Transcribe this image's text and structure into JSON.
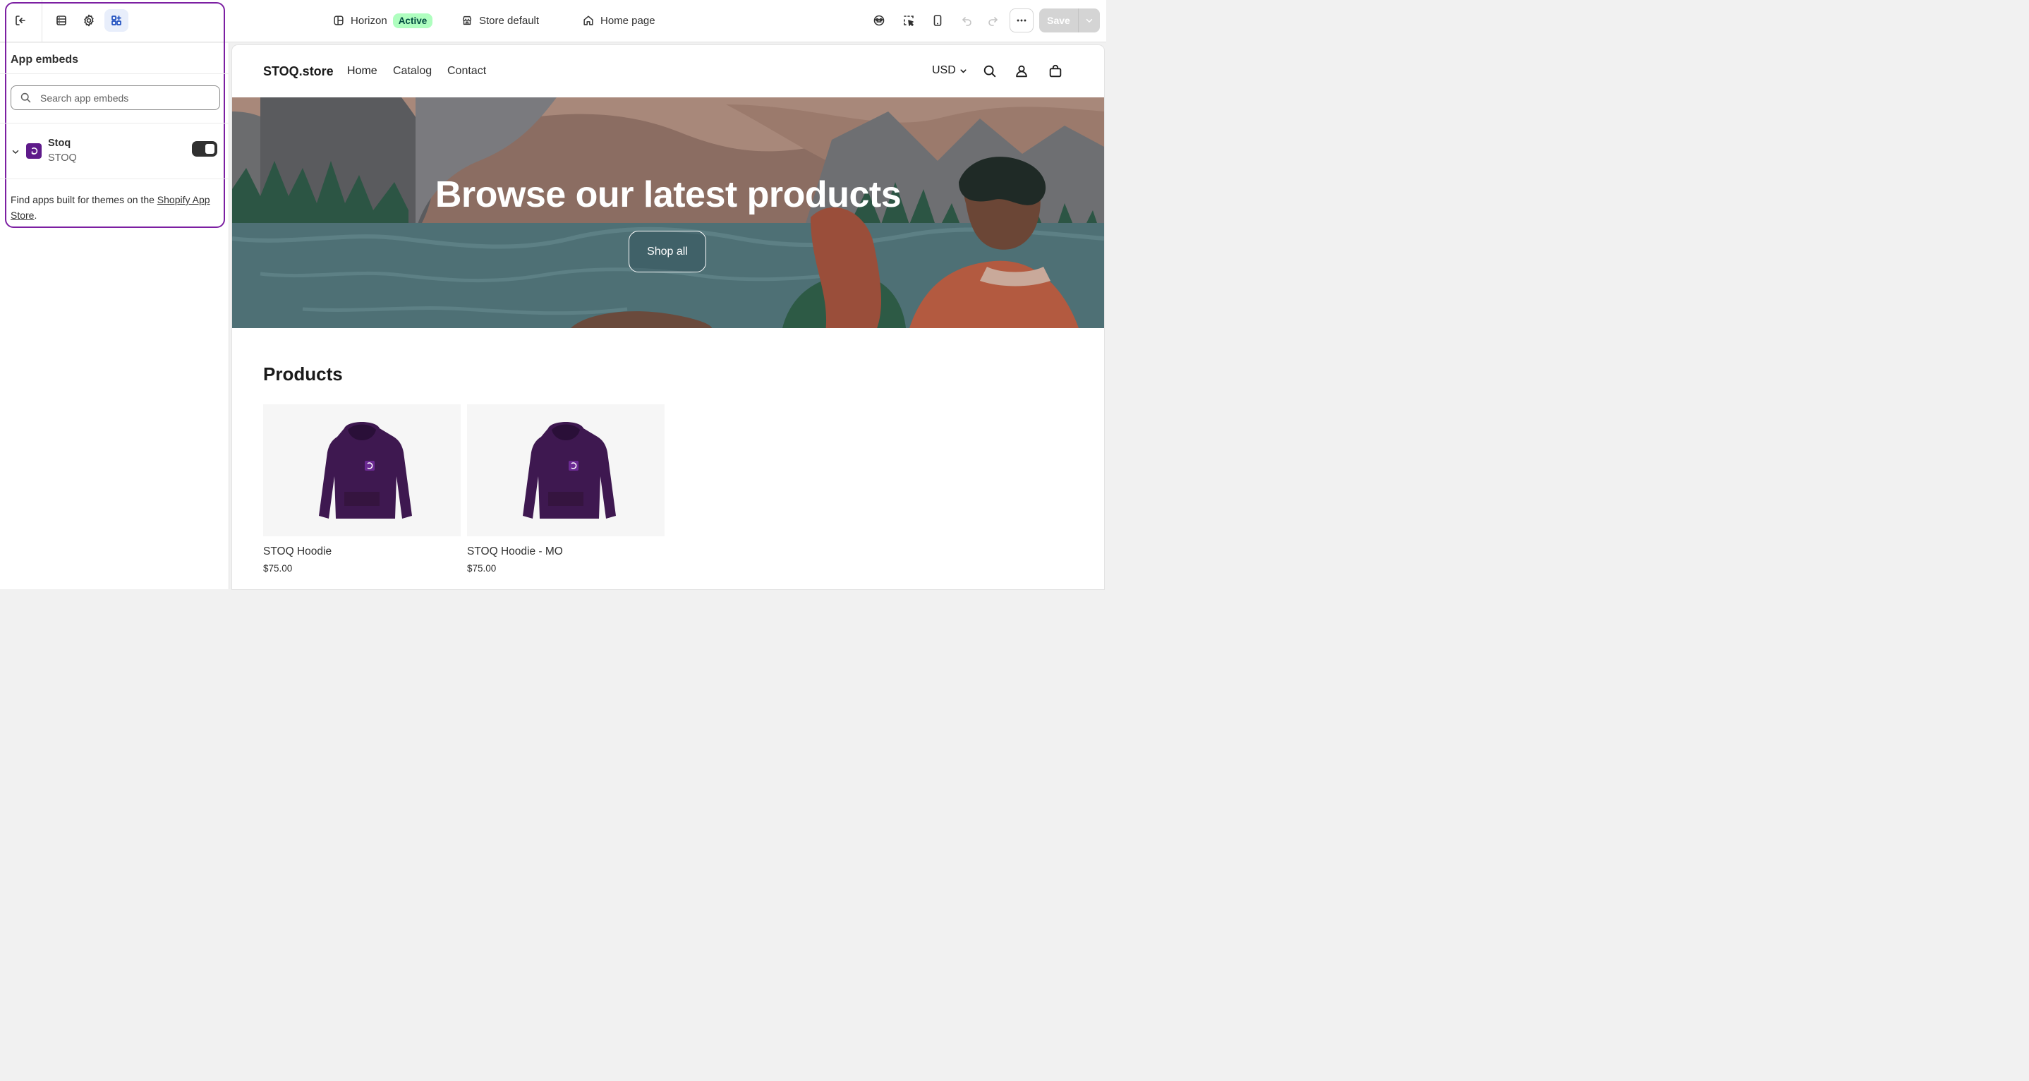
{
  "topbar": {
    "theme_name": "Horizon",
    "theme_status": "Active",
    "store_context": "Store default",
    "page_template": "Home page",
    "save_label": "Save"
  },
  "sidebar": {
    "panel_title": "App embeds",
    "search_placeholder": "Search app embeds",
    "app": {
      "name": "Stoq",
      "vendor": "STOQ",
      "enabled": true
    },
    "footer_prefix": "Find apps built for themes on the ",
    "footer_link": "Shopify App Store",
    "footer_suffix": "."
  },
  "store": {
    "brand": "STOQ.store",
    "nav": [
      "Home",
      "Catalog",
      "Contact"
    ],
    "currency": "USD",
    "hero_title": "Browse our latest products",
    "hero_button": "Shop all",
    "products_title": "Products",
    "products": [
      {
        "name": "STOQ Hoodie",
        "price": "$75.00"
      },
      {
        "name": "STOQ Hoodie - MO",
        "price": "$75.00"
      }
    ]
  },
  "colors": {
    "accent_focus": "#7c1fa2",
    "badge_bg": "#affebf",
    "app_logo": "#5e1a8a",
    "hoodie": "#3e1850"
  }
}
